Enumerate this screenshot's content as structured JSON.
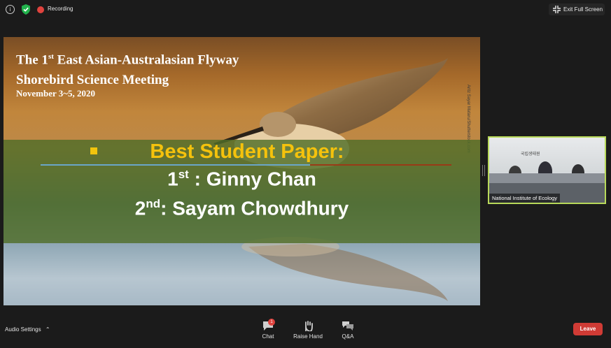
{
  "topbar": {
    "info_icon": "info-icon",
    "shield_icon": "shield-icon",
    "recording_label": "Recording",
    "exit_fullscreen_label": "Exit Full Screen"
  },
  "slide": {
    "title_line1_pre": "The 1",
    "title_line1_sup": "st",
    "title_line1_post": " East Asian-Australasian Flyway",
    "title_line2": "Shorebird Science Meeting",
    "date": "November 3~5, 2020",
    "credit": "Aritz Sayar Mataru/Shutterstock.com",
    "award_heading": "Best Student Paper:",
    "first_place_pre": "1",
    "first_place_sup": "st",
    "first_place_post": " : Ginny Chan",
    "second_place_pre": "2",
    "second_place_sup": "nd",
    "second_place_post": ": Sayam Chowdhury"
  },
  "video": {
    "participant_name": "National Institute of Ecology",
    "sign_text": "국립생태원"
  },
  "bottombar": {
    "audio_settings_label": "Audio Settings",
    "chat_label": "Chat",
    "chat_badge": "1",
    "raise_hand_label": "Raise Hand",
    "qa_label": "Q&A",
    "leave_label": "Leave"
  },
  "colors": {
    "accent_green": "#b8d95a",
    "leave_red": "#d03b35",
    "award_yellow": "#f5c20c",
    "band_green": "#506e28"
  }
}
